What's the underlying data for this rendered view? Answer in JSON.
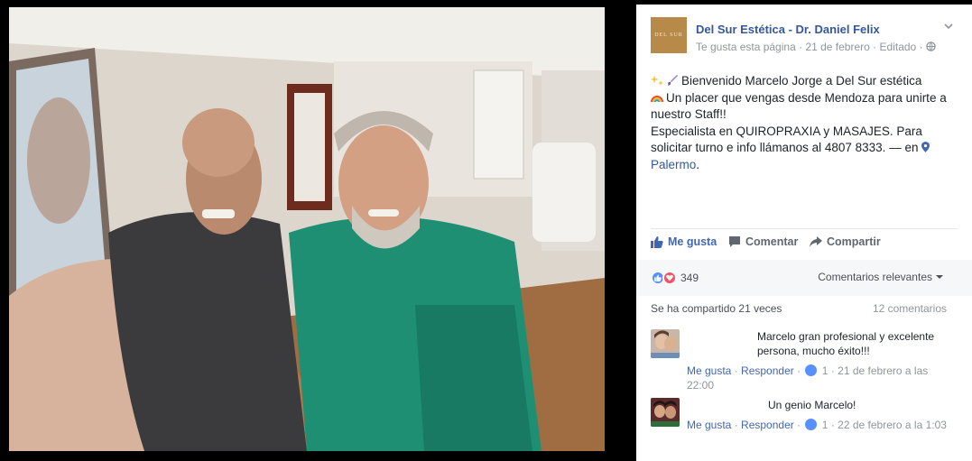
{
  "post": {
    "page_name": "Del Sur Estética - Dr. Daniel Felix",
    "avatar_text": "DEL SUR",
    "meta_like": "Te gusta esta página",
    "meta_date": "21 de febrero",
    "meta_edited": "Editado",
    "text_line1": "Bienvenido Marcelo Jorge a Del Sur estética",
    "text_line2": "Un placer que vengas desde Mendoza para unirte a nuestro Staff!!",
    "text_line3": "Especialista en QUIROPRAXIA y MASAJES. Para solicitar turno e info llámanos al 4807 8333.",
    "text_en": "— en",
    "location": "Palermo",
    "location_suffix": "."
  },
  "actions": {
    "like": "Me gusta",
    "comment": "Comentar",
    "share": "Compartir"
  },
  "reactions": {
    "count": "349",
    "sort_label": "Comentarios relevantes"
  },
  "shares": {
    "shared": "Se ha compartido 21 veces",
    "comments_count": "12 comentarios"
  },
  "comments": [
    {
      "text": "Marcelo gran profesional y excelente persona, mucho éxito!!!",
      "like": "Me gusta",
      "reply": "Responder",
      "likes": "1",
      "time": "21 de febrero a las 22:00"
    },
    {
      "text": "Un genio Marcelo!",
      "like": "Me gusta",
      "reply": "Responder",
      "likes": "1",
      "time": "22 de febrero a la 1:03"
    }
  ],
  "colors": {
    "link": "#365899",
    "action_blue": "#4267b2",
    "love": "#f25268",
    "like": "#5890ff"
  }
}
